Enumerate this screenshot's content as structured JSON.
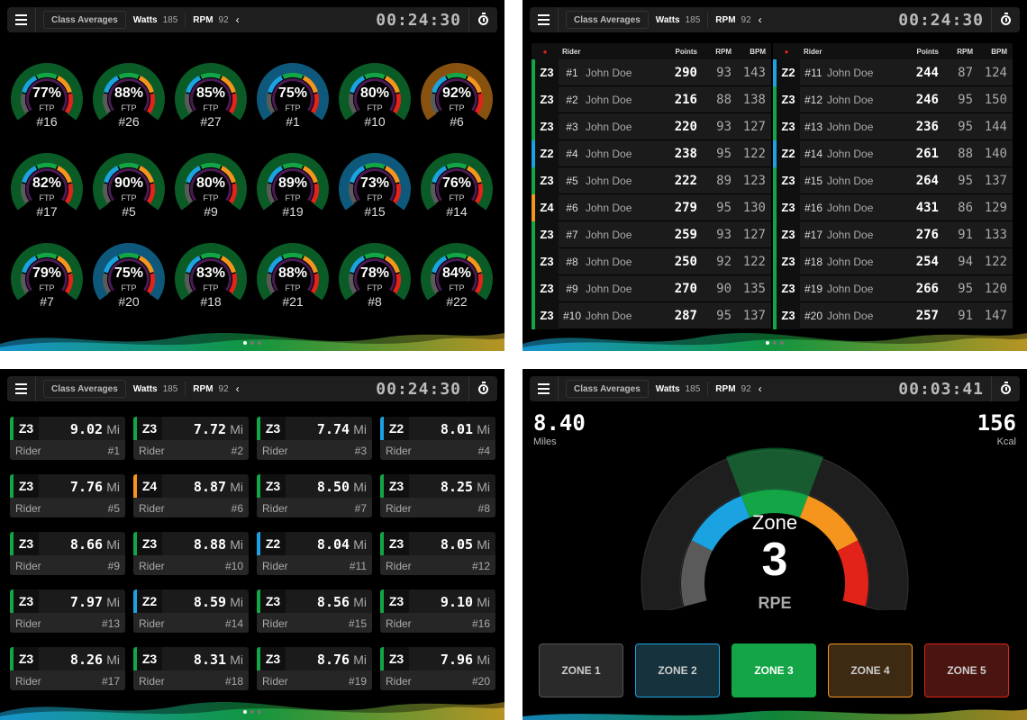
{
  "topbar": {
    "class_averages": "Class Averages",
    "watts_label": "Watts",
    "watts_value": "185",
    "rpm_label": "RPM",
    "rpm_value": "92",
    "chevron": "‹",
    "timer": "00:24:30",
    "timer2": "00:03:41"
  },
  "colors": {
    "Z1": "#5a5a5a",
    "Z2": "#1aa3e0",
    "Z3": "#13a546",
    "Z4": "#f5951d",
    "Z5": "#e2231a"
  },
  "gauges": [
    {
      "pct": "77%",
      "ftp": "FTP",
      "num": "#16",
      "zone": 3
    },
    {
      "pct": "88%",
      "ftp": "FTP",
      "num": "#26",
      "zone": 3
    },
    {
      "pct": "85%",
      "ftp": "FTP",
      "num": "#27",
      "zone": 3
    },
    {
      "pct": "75%",
      "ftp": "FTP",
      "num": "#1",
      "zone": 2
    },
    {
      "pct": "80%",
      "ftp": "FTP",
      "num": "#10",
      "zone": 3
    },
    {
      "pct": "92%",
      "ftp": "FTP",
      "num": "#6",
      "zone": 4
    },
    {
      "pct": "82%",
      "ftp": "FTP",
      "num": "#17",
      "zone": 3
    },
    {
      "pct": "90%",
      "ftp": "FTP",
      "num": "#5",
      "zone": 3
    },
    {
      "pct": "80%",
      "ftp": "FTP",
      "num": "#9",
      "zone": 3
    },
    {
      "pct": "89%",
      "ftp": "FTP",
      "num": "#19",
      "zone": 3
    },
    {
      "pct": "73%",
      "ftp": "FTP",
      "num": "#15",
      "zone": 2
    },
    {
      "pct": "76%",
      "ftp": "FTP",
      "num": "#14",
      "zone": 3
    },
    {
      "pct": "79%",
      "ftp": "FTP",
      "num": "#7",
      "zone": 3
    },
    {
      "pct": "75%",
      "ftp": "FTP",
      "num": "#20",
      "zone": 2
    },
    {
      "pct": "83%",
      "ftp": "FTP",
      "num": "#18",
      "zone": 3
    },
    {
      "pct": "88%",
      "ftp": "FTP",
      "num": "#21",
      "zone": 3
    },
    {
      "pct": "78%",
      "ftp": "FTP",
      "num": "#8",
      "zone": 3
    },
    {
      "pct": "84%",
      "ftp": "FTP",
      "num": "#22",
      "zone": 3
    }
  ],
  "table": {
    "headers": {
      "rider": "Rider",
      "points": "Points",
      "rpm": "RPM",
      "bpm": "BPM"
    },
    "left": [
      {
        "z": "Z3",
        "n": "#1",
        "name": "John Doe",
        "pts": "290",
        "rpm": "93",
        "bpm": "143"
      },
      {
        "z": "Z3",
        "n": "#2",
        "name": "John Doe",
        "pts": "216",
        "rpm": "88",
        "bpm": "138"
      },
      {
        "z": "Z3",
        "n": "#3",
        "name": "John Doe",
        "pts": "220",
        "rpm": "93",
        "bpm": "127"
      },
      {
        "z": "Z2",
        "n": "#4",
        "name": "John Doe",
        "pts": "238",
        "rpm": "95",
        "bpm": "122"
      },
      {
        "z": "Z3",
        "n": "#5",
        "name": "John Doe",
        "pts": "222",
        "rpm": "89",
        "bpm": "123"
      },
      {
        "z": "Z4",
        "n": "#6",
        "name": "John Doe",
        "pts": "279",
        "rpm": "95",
        "bpm": "130"
      },
      {
        "z": "Z3",
        "n": "#7",
        "name": "John Doe",
        "pts": "259",
        "rpm": "93",
        "bpm": "127"
      },
      {
        "z": "Z3",
        "n": "#8",
        "name": "John Doe",
        "pts": "250",
        "rpm": "92",
        "bpm": "122"
      },
      {
        "z": "Z3",
        "n": "#9",
        "name": "John Doe",
        "pts": "270",
        "rpm": "90",
        "bpm": "135"
      },
      {
        "z": "Z3",
        "n": "#10",
        "name": "John Doe",
        "pts": "287",
        "rpm": "95",
        "bpm": "137"
      }
    ],
    "right": [
      {
        "z": "Z2",
        "n": "#11",
        "name": "John Doe",
        "pts": "244",
        "rpm": "87",
        "bpm": "124"
      },
      {
        "z": "Z3",
        "n": "#12",
        "name": "John Doe",
        "pts": "246",
        "rpm": "95",
        "bpm": "150"
      },
      {
        "z": "Z3",
        "n": "#13",
        "name": "John Doe",
        "pts": "236",
        "rpm": "95",
        "bpm": "144"
      },
      {
        "z": "Z2",
        "n": "#14",
        "name": "John Doe",
        "pts": "261",
        "rpm": "88",
        "bpm": "140"
      },
      {
        "z": "Z3",
        "n": "#15",
        "name": "John Doe",
        "pts": "264",
        "rpm": "95",
        "bpm": "137"
      },
      {
        "z": "Z3",
        "n": "#16",
        "name": "John Doe",
        "pts": "431",
        "rpm": "86",
        "bpm": "129"
      },
      {
        "z": "Z3",
        "n": "#17",
        "name": "John Doe",
        "pts": "276",
        "rpm": "91",
        "bpm": "133"
      },
      {
        "z": "Z3",
        "n": "#18",
        "name": "John Doe",
        "pts": "254",
        "rpm": "94",
        "bpm": "122"
      },
      {
        "z": "Z3",
        "n": "#19",
        "name": "John Doe",
        "pts": "266",
        "rpm": "95",
        "bpm": "120"
      },
      {
        "z": "Z3",
        "n": "#20",
        "name": "John Doe",
        "pts": "257",
        "rpm": "91",
        "bpm": "147"
      }
    ]
  },
  "cards": [
    {
      "z": "Z3",
      "v": "9.02",
      "u": "Mi",
      "l": "Rider",
      "n": "#1"
    },
    {
      "z": "Z3",
      "v": "7.72",
      "u": "Mi",
      "l": "Rider",
      "n": "#2"
    },
    {
      "z": "Z3",
      "v": "7.74",
      "u": "Mi",
      "l": "Rider",
      "n": "#3"
    },
    {
      "z": "Z2",
      "v": "8.01",
      "u": "Mi",
      "l": "Rider",
      "n": "#4"
    },
    {
      "z": "Z3",
      "v": "7.76",
      "u": "Mi",
      "l": "Rider",
      "n": "#5"
    },
    {
      "z": "Z4",
      "v": "8.87",
      "u": "Mi",
      "l": "Rider",
      "n": "#6"
    },
    {
      "z": "Z3",
      "v": "8.50",
      "u": "Mi",
      "l": "Rider",
      "n": "#7"
    },
    {
      "z": "Z3",
      "v": "8.25",
      "u": "Mi",
      "l": "Rider",
      "n": "#8"
    },
    {
      "z": "Z3",
      "v": "8.66",
      "u": "Mi",
      "l": "Rider",
      "n": "#9"
    },
    {
      "z": "Z3",
      "v": "8.88",
      "u": "Mi",
      "l": "Rider",
      "n": "#10"
    },
    {
      "z": "Z2",
      "v": "8.04",
      "u": "Mi",
      "l": "Rider",
      "n": "#11"
    },
    {
      "z": "Z3",
      "v": "8.05",
      "u": "Mi",
      "l": "Rider",
      "n": "#12"
    },
    {
      "z": "Z3",
      "v": "7.97",
      "u": "Mi",
      "l": "Rider",
      "n": "#13"
    },
    {
      "z": "Z2",
      "v": "8.59",
      "u": "Mi",
      "l": "Rider",
      "n": "#14"
    },
    {
      "z": "Z3",
      "v": "8.56",
      "u": "Mi",
      "l": "Rider",
      "n": "#15"
    },
    {
      "z": "Z3",
      "v": "9.10",
      "u": "Mi",
      "l": "Rider",
      "n": "#16"
    },
    {
      "z": "Z3",
      "v": "8.26",
      "u": "Mi",
      "l": "Rider",
      "n": "#17"
    },
    {
      "z": "Z3",
      "v": "8.31",
      "u": "Mi",
      "l": "Rider",
      "n": "#18"
    },
    {
      "z": "Z3",
      "v": "8.76",
      "u": "Mi",
      "l": "Rider",
      "n": "#19"
    },
    {
      "z": "Z3",
      "v": "7.96",
      "u": "Mi",
      "l": "Rider",
      "n": "#20"
    }
  ],
  "rpe": {
    "miles_value": "8.40",
    "miles_label": "Miles",
    "kcal_value": "156",
    "kcal_label": "Kcal",
    "zone_label": "Zone",
    "zone_value": "3",
    "rpe_label": "RPE",
    "current_zone": 3,
    "buttons": [
      "ZONE 1",
      "ZONE 2",
      "ZONE 3",
      "ZONE 4",
      "ZONE 5"
    ]
  }
}
